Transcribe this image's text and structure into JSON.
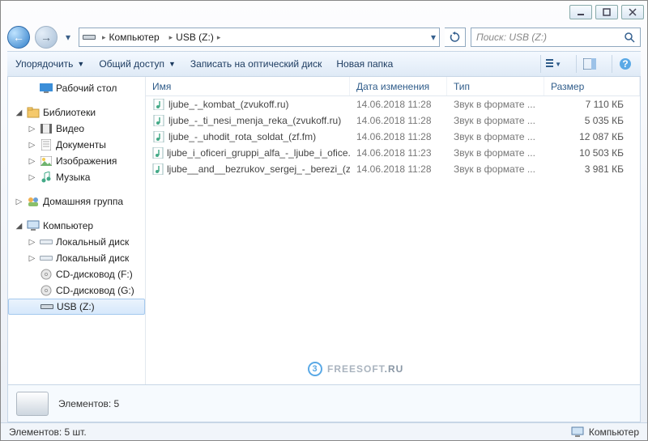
{
  "breadcrumb": {
    "root": "Компьютер",
    "current": "USB (Z:)"
  },
  "search": {
    "placeholder": "Поиск: USB (Z:)"
  },
  "toolbar": {
    "organize": "Упорядочить",
    "share": "Общий доступ",
    "burn": "Записать на оптический диск",
    "newfolder": "Новая папка"
  },
  "sidebar": {
    "desktop": "Рабочий стол",
    "libraries": "Библиотеки",
    "video": "Видео",
    "documents": "Документы",
    "pictures": "Изображения",
    "music": "Музыка",
    "homegroup": "Домашняя группа",
    "computer": "Компьютер",
    "localdisk1": "Локальный диск",
    "localdisk2": "Локальный диск",
    "cdf": "CD-дисковод (F:)",
    "cdg": "CD-дисковод (G:)",
    "usbz": "USB (Z:)"
  },
  "columns": {
    "name": "Имя",
    "date": "Дата изменения",
    "type": "Тип",
    "size": "Размер"
  },
  "files": [
    {
      "name": "ljube_-_kombat_(zvukoff.ru)",
      "date": "14.06.2018 11:28",
      "type": "Звук в формате ...",
      "size": "7 110 КБ"
    },
    {
      "name": "ljube_-_ti_nesi_menja_reka_(zvukoff.ru)",
      "date": "14.06.2018 11:28",
      "type": "Звук в формате ...",
      "size": "5 035 КБ"
    },
    {
      "name": "ljube_-_uhodit_rota_soldat_(zf.fm)",
      "date": "14.06.2018 11:28",
      "type": "Звук в формате ...",
      "size": "12 087 КБ"
    },
    {
      "name": "ljube_i_oficeri_gruppi_alfa_-_ljube_i_ofice...",
      "date": "14.06.2018 11:23",
      "type": "Звук в формате ...",
      "size": "10 503 КБ"
    },
    {
      "name": "ljube__and__bezrukov_sergej_-_berezi_(zv...",
      "date": "14.06.2018 11:28",
      "type": "Звук в формате ...",
      "size": "3 981 КБ"
    }
  ],
  "details": {
    "text": "Элементов: 5"
  },
  "status": {
    "left": "Элементов: 5 шт.",
    "right": "Компьютер"
  },
  "watermark": {
    "brand": "FREESOFT",
    "tld": ".RU",
    "badge": "3"
  }
}
